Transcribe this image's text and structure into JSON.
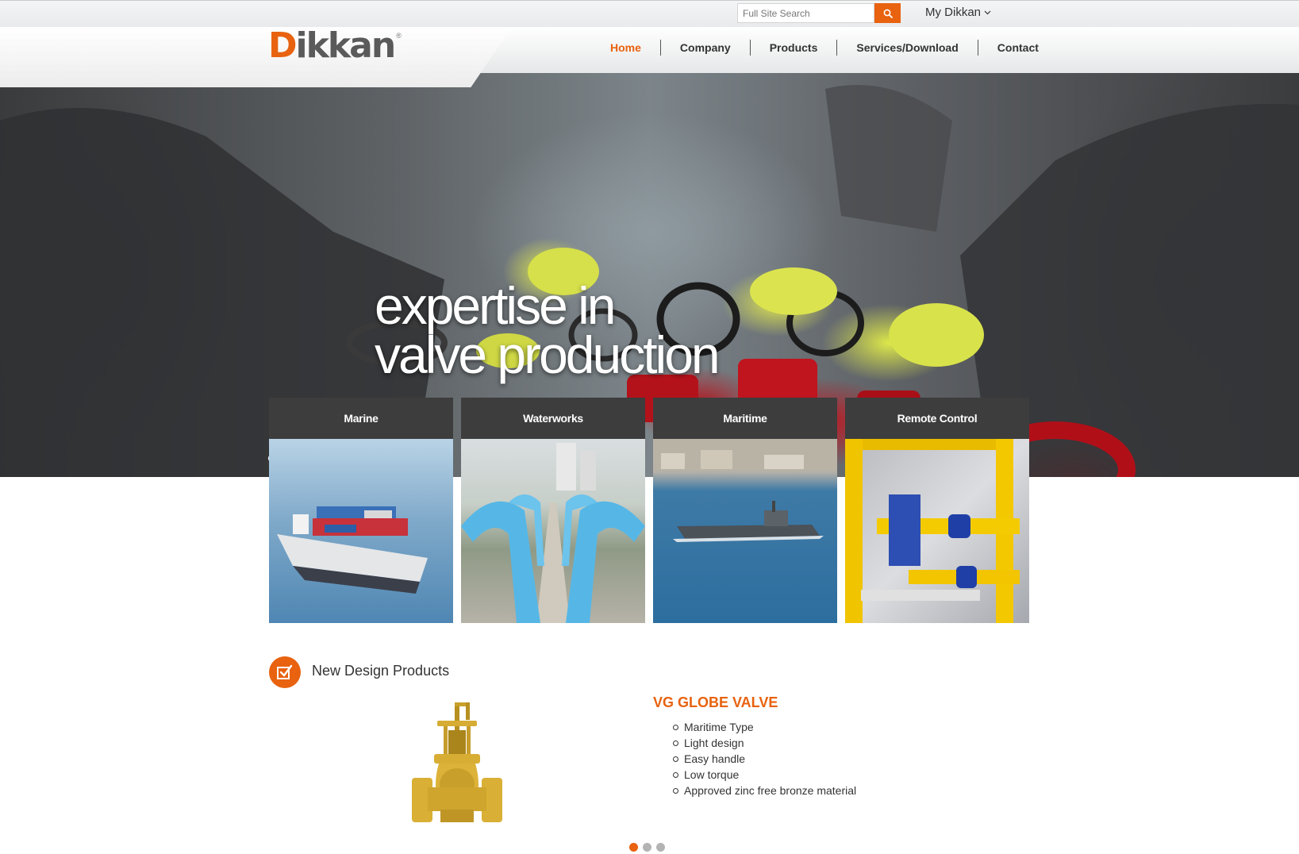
{
  "search": {
    "placeholder": "Full Site Search"
  },
  "account": {
    "label": "My Dikkan"
  },
  "brand": {
    "name": "Dikkan",
    "reg": "®"
  },
  "nav": {
    "items": [
      {
        "label": "Home",
        "active": true
      },
      {
        "label": "Company",
        "active": false
      },
      {
        "label": "Products",
        "active": false
      },
      {
        "label": "Services/Download",
        "active": false
      },
      {
        "label": "Contact",
        "active": false
      }
    ]
  },
  "hero": {
    "line1": "expertise in",
    "line2": "valve production",
    "slide_count": 3,
    "active_slide": 2
  },
  "categories": [
    {
      "label": "Marine"
    },
    {
      "label": "Waterworks"
    },
    {
      "label": "Maritime"
    },
    {
      "label": "Remote Control"
    }
  ],
  "new_products": {
    "title": "New Design Products",
    "product": {
      "name": "VG GLOBE VALVE",
      "features": [
        "Maritime Type",
        "Light design",
        "Easy handle",
        "Low torque",
        "Approved zinc free bronze material"
      ]
    },
    "pager_count": 3,
    "active_page": 1
  },
  "colors": {
    "accent": "#e8620f",
    "dark_tile": "#3d3d3d",
    "text": "#333333"
  },
  "icons": [
    "search-icon",
    "chevron-down-icon",
    "checkbox-icon"
  ]
}
